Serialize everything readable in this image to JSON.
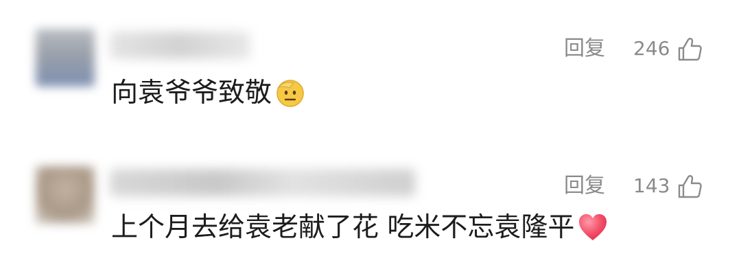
{
  "comments": [
    {
      "text": "向袁爷爷致敬",
      "emoji": "salute-face",
      "reply_label": "回复",
      "likes": "246"
    },
    {
      "text": "上个月去给袁老献了花 吃米不忘袁隆平",
      "emoji": "red-heart",
      "reply_label": "回复",
      "likes": "143"
    }
  ],
  "colors": {
    "meta_text": "#8a8a8a",
    "body_text": "#1c1c1c",
    "emoji_yellow": "#f6c945",
    "heart": "#f4506a"
  }
}
